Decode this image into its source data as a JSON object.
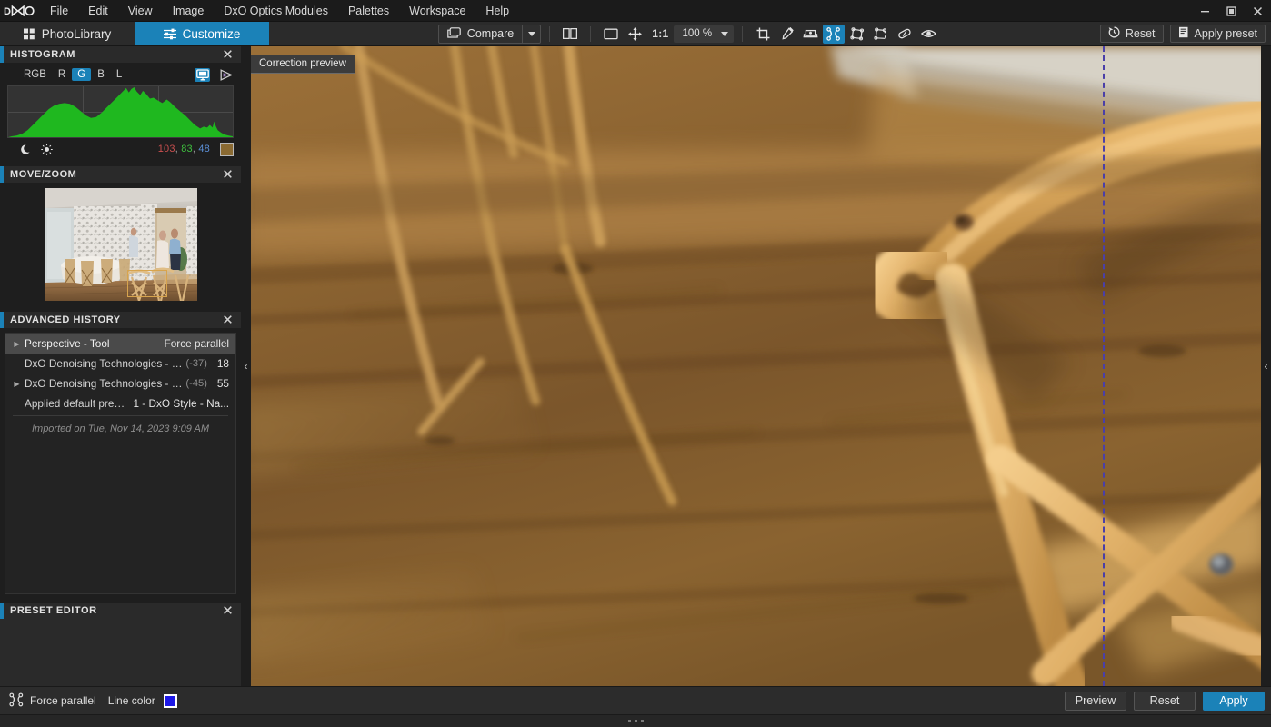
{
  "app": {
    "logo": "DxO",
    "window_controls": {
      "minimize": "minimize-icon",
      "maximize": "maximize-icon",
      "close": "close-icon"
    }
  },
  "menubar": {
    "items": [
      {
        "label": "File"
      },
      {
        "label": "Edit"
      },
      {
        "label": "View"
      },
      {
        "label": "Image"
      },
      {
        "label": "DxO Optics Modules"
      },
      {
        "label": "Palettes"
      },
      {
        "label": "Workspace"
      },
      {
        "label": "Help"
      }
    ]
  },
  "tabs": [
    {
      "label": "PhotoLibrary",
      "icon": "grid-icon",
      "active": false
    },
    {
      "label": "Customize",
      "icon": "sliders-icon",
      "active": true
    }
  ],
  "toolbar": {
    "compare": {
      "label": "Compare",
      "icon": "compare-icon",
      "dropdown": "chevron-down-icon"
    },
    "side_by_side_icon": "split-view-icon",
    "fit_icon": "fit-to-screen-icon",
    "pan_icon": "move-hand-icon",
    "ratio_label": "1:1",
    "zoom_value": "100 %",
    "zoom_dropdown": "chevron-down-icon",
    "tools": [
      {
        "name": "crop-tool",
        "icon": "crop-icon",
        "active": false
      },
      {
        "name": "color-picker-tool",
        "icon": "eyedropper-icon",
        "active": false
      },
      {
        "name": "horizon-tool",
        "icon": "horizon-level-icon",
        "active": false
      },
      {
        "name": "force-parallel-tool",
        "icon": "force-parallel-icon",
        "active": true
      },
      {
        "name": "perspective-rectangle-tool",
        "icon": "perspective-rect-icon",
        "active": false
      },
      {
        "name": "perspective-8pt-tool",
        "icon": "perspective-8pt-icon",
        "active": false
      },
      {
        "name": "repair-tool",
        "icon": "repair-patch-icon",
        "active": false
      },
      {
        "name": "preview-eye-tool",
        "icon": "eye-icon",
        "active": false
      }
    ],
    "reset": {
      "label": "Reset",
      "icon": "reset-clock-icon"
    },
    "apply_preset": {
      "label": "Apply preset",
      "icon": "preset-document-icon"
    }
  },
  "left_panel": {
    "histogram": {
      "title": "HISTOGRAM",
      "close_icon": "close-icon",
      "channels": [
        {
          "label": "RGB",
          "selected": false
        },
        {
          "label": "R",
          "selected": false
        },
        {
          "label": "G",
          "selected": true
        },
        {
          "label": "B",
          "selected": false
        },
        {
          "label": "L",
          "selected": false
        }
      ],
      "right_icons": [
        {
          "name": "monitor-icon",
          "active": true
        },
        {
          "name": "soft-proof-icon",
          "active": false
        }
      ],
      "shadow_icon": "moon-icon",
      "highlight_icon": "sun-icon",
      "rgb_readout": {
        "r": "103",
        "g": "83",
        "b": "48",
        "separator": ", "
      },
      "swatch_color": "#8a6a32",
      "colors": {
        "r": "#c94f4f",
        "g": "#3fbf3f",
        "b": "#5b8fd6",
        "fill": "#1fb81f"
      },
      "curve": "0,58 4,57 10,56 16,54 22,50 28,44 34,38 40,32 46,26 52,22 58,20 64,19 70,20 76,23 82,28 88,33 94,36 100,35 106,30 112,24 118,18 124,12 130,6 134,2 137,7 140,3 143,1 146,6 150,10 153,5 157,9 161,14 165,13 170,16 175,19 180,15 184,18 190,24 196,29 201,33 206,38 212,44 218,48 222,46 226,47 229,44 232,47 234,40 236,46 238,50 242,53 246,55 250,56 255,57"
    },
    "move_zoom": {
      "title": "MOVE/ZOOM",
      "close_icon": "close-icon",
      "thumbnail_alt": "room-thumbnail",
      "viewport_rect": "crop-viewport-rectangle"
    },
    "advanced_history": {
      "title": "ADVANCED HISTORY",
      "close_icon": "close-icon",
      "rows": [
        {
          "twist": true,
          "label": "Perspective - Tool",
          "delta": "",
          "value": "Force parallel",
          "selected": true
        },
        {
          "twist": false,
          "label": "DxO Denoising Technologies - Lu...",
          "delta": "(-37)",
          "value": "18",
          "selected": false
        },
        {
          "twist": true,
          "label": "DxO Denoising Technologies - Lu...",
          "delta": "(-45)",
          "value": "55",
          "selected": false
        },
        {
          "twist": false,
          "label": "Applied default preset",
          "delta": "",
          "value": "1 - DxO Style - Na...",
          "selected": false
        }
      ],
      "imported_note": "Imported on Tue, Nov 14, 2023 9:09 AM"
    },
    "preset_editor": {
      "title": "PRESET EDITOR",
      "close_icon": "close-icon"
    }
  },
  "viewer": {
    "correction_preview_badge": "Correction preview",
    "guide_line": {
      "name": "force-parallel-guide-line",
      "color": "#4a3fa8",
      "style": "dashed"
    },
    "collapse_left_icon": "chevron-left-icon",
    "collapse_right_icon": "chevron-left-icon"
  },
  "bottom_bar": {
    "tool_icon": "force-parallel-icon",
    "tool_label": "Force parallel",
    "line_color_label": "Line color",
    "line_color_value": "#1d18e6",
    "buttons": [
      {
        "label": "Preview",
        "primary": false
      },
      {
        "label": "Reset",
        "primary": false
      },
      {
        "label": "Apply",
        "primary": true
      }
    ]
  },
  "status_bar": {
    "grip": "resize-grip-icon"
  }
}
